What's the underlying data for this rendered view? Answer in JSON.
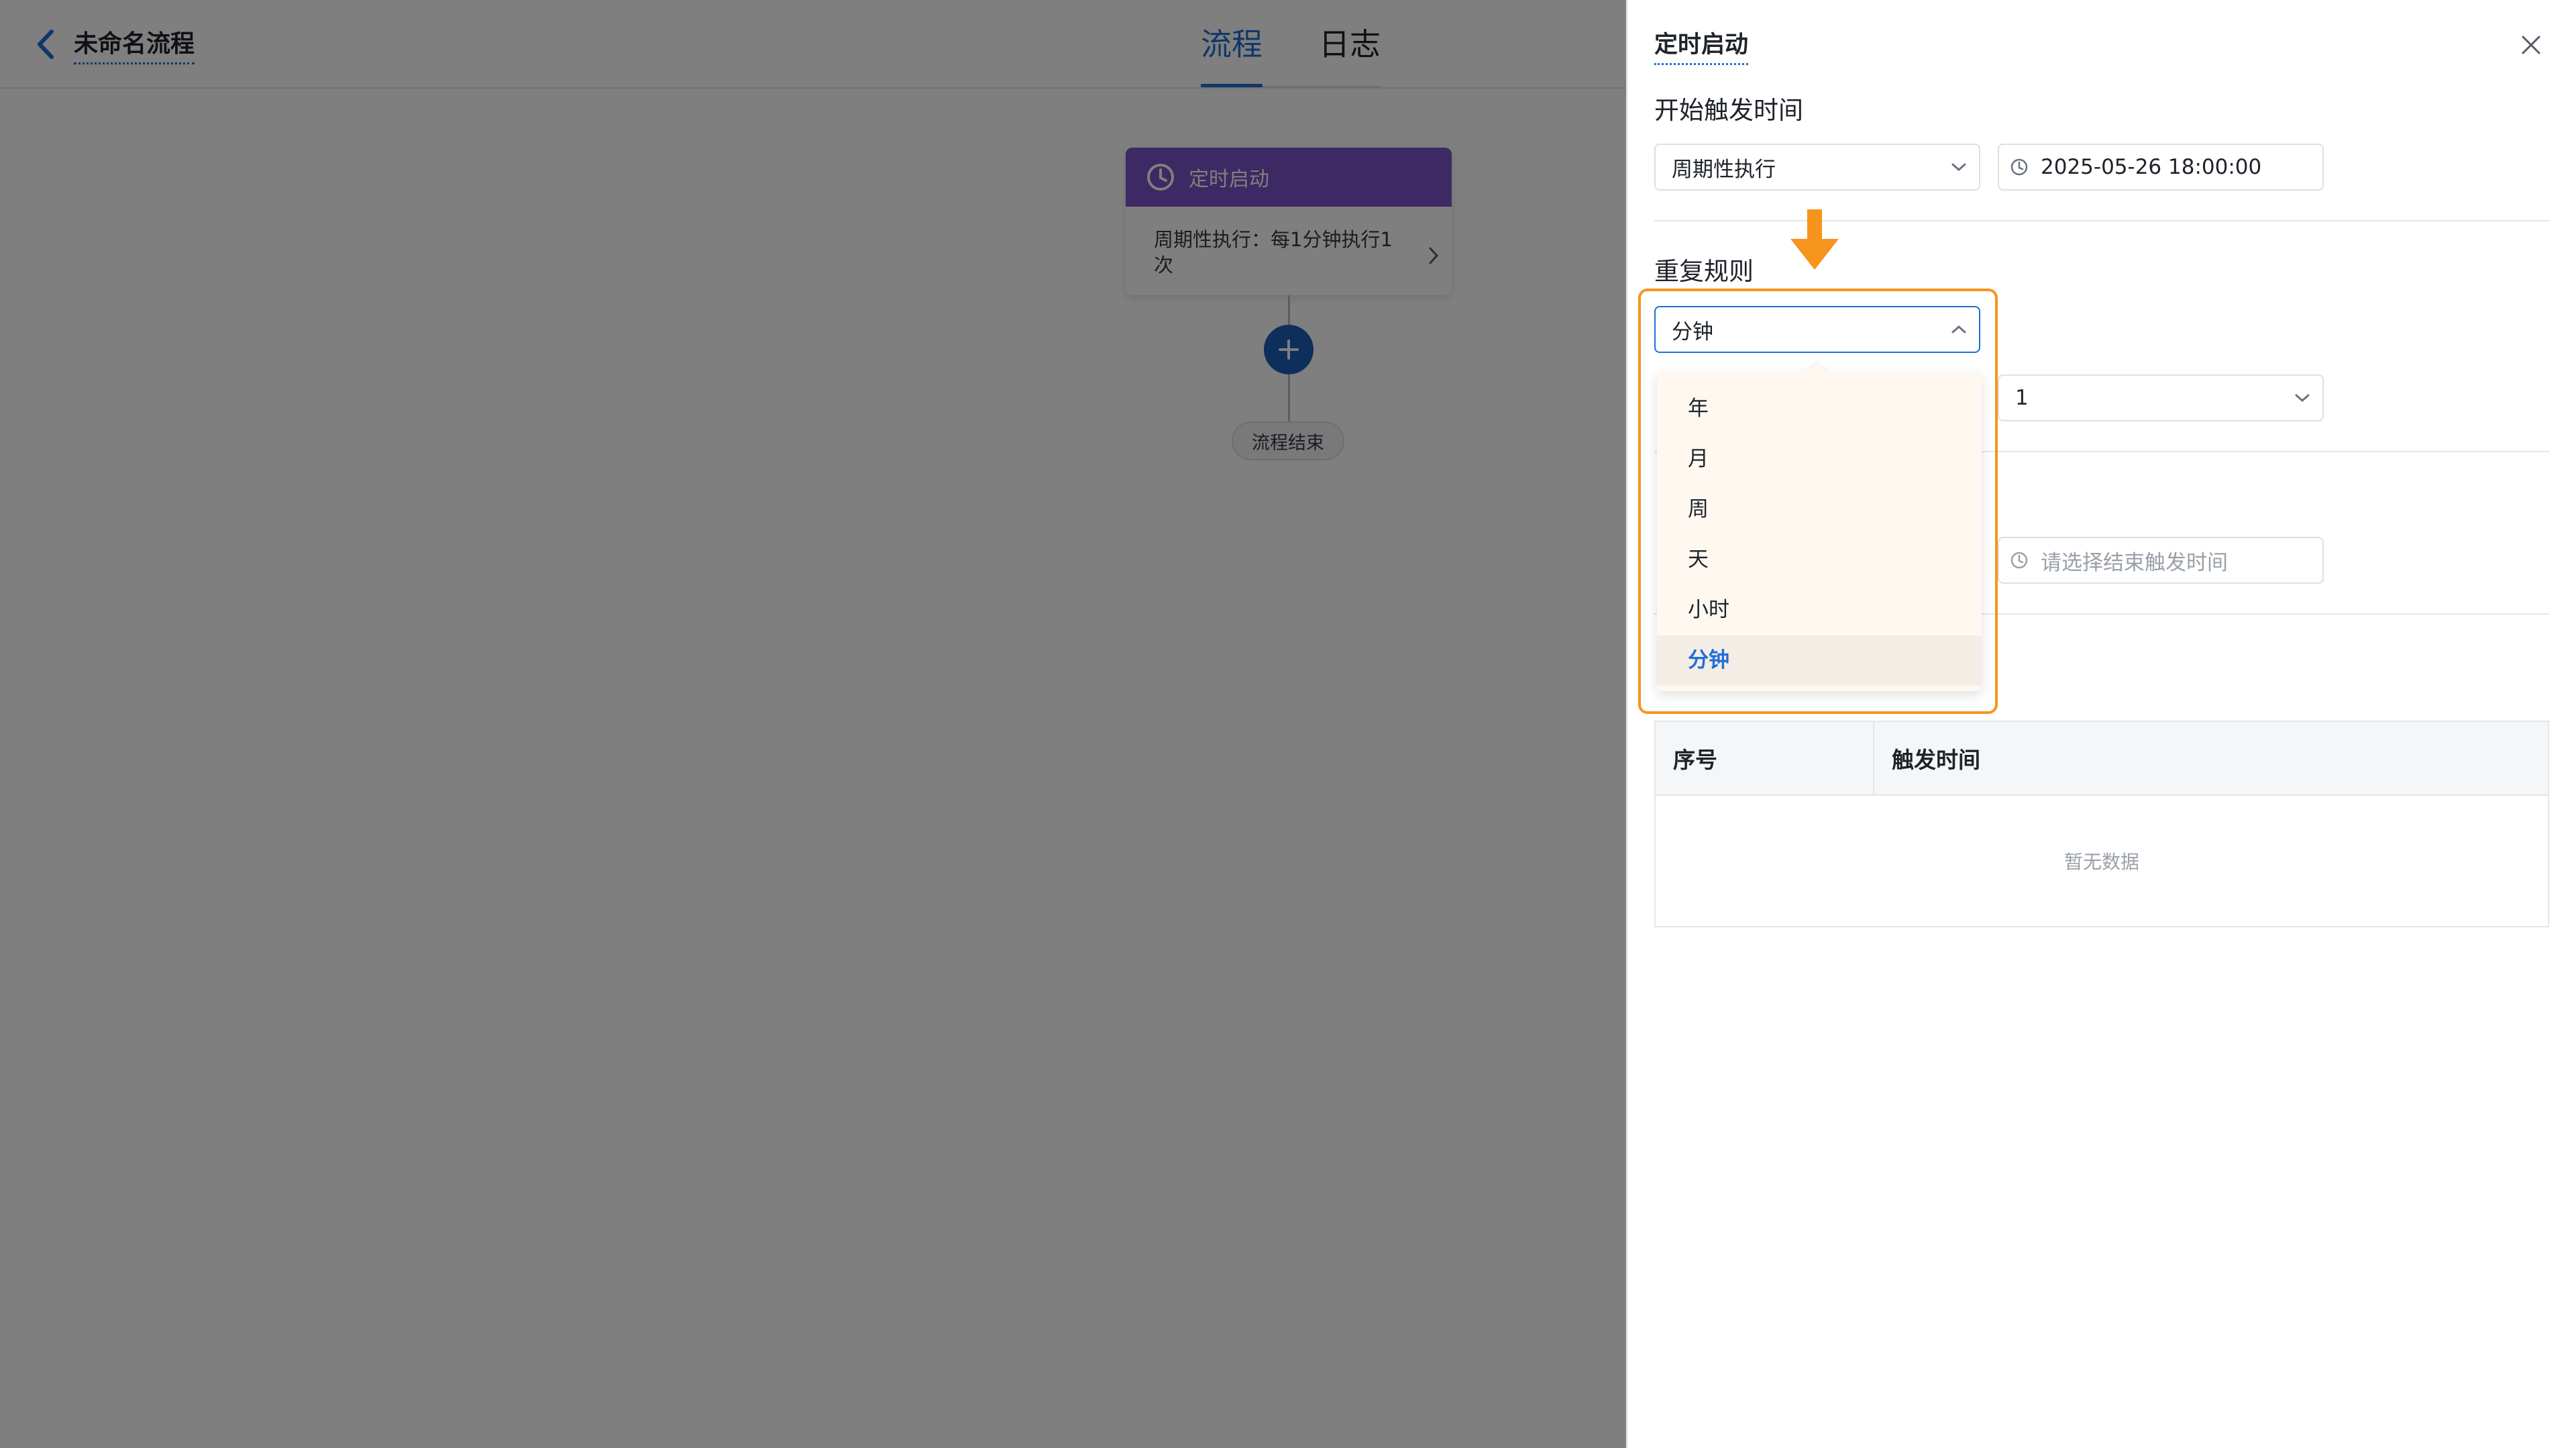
{
  "header": {
    "title": "未命名流程",
    "tabs": [
      {
        "label": "流程",
        "active": true
      },
      {
        "label": "日志",
        "active": false
      }
    ]
  },
  "canvas": {
    "trigger_node": {
      "label": "定时启动",
      "summary": "周期性执行：每1分钟执行1次",
      "header_color": "#7b52c7"
    },
    "end_label": "流程结束"
  },
  "drawer": {
    "title": "定时启动",
    "start_section": {
      "label": "开始触发时间",
      "mode_value": "周期性执行",
      "datetime_value": "2025-05-26 18:00:00"
    },
    "repeat_section": {
      "label": "重复规则",
      "unit_value": "分钟",
      "interval_value": "1",
      "options": [
        "年",
        "月",
        "周",
        "天",
        "小时",
        "分钟"
      ],
      "selected_option": "分钟"
    },
    "end_section": {
      "end_time_placeholder": "请选择结束触发时间"
    },
    "preview_table": {
      "columns": [
        "序号",
        "触发时间"
      ],
      "empty_text": "暂无数据"
    }
  },
  "colors": {
    "accent": "#1f6fd6",
    "highlight": "#f7941d",
    "add_button": "#1c5fb8"
  },
  "icons": {
    "back": "chevron-left-icon",
    "close": "close-icon",
    "clock": "clock-icon",
    "dropdown": "chevron-down-icon",
    "dropdown_open": "chevron-up-icon",
    "add": "plus-icon",
    "indicator": "arrow-down-icon"
  }
}
